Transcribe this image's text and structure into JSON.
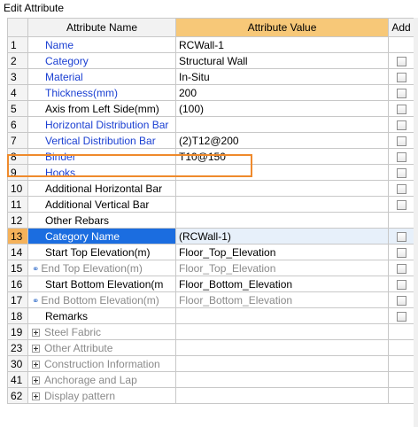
{
  "window": {
    "title": "Edit Attribute"
  },
  "header": {
    "num": "",
    "name": "Attribute Name",
    "value": "Attribute Value",
    "add": "Add"
  },
  "rows": [
    {
      "num": "1",
      "name": "Name",
      "value": "RCWall-1",
      "style": "blue",
      "add": false,
      "icon": ""
    },
    {
      "num": "2",
      "name": "Category",
      "value": "Structural Wall",
      "style": "blue",
      "add": true,
      "icon": ""
    },
    {
      "num": "3",
      "name": "Material",
      "value": "In-Situ",
      "style": "blue",
      "add": true,
      "icon": ""
    },
    {
      "num": "4",
      "name": "Thickness(mm)",
      "value": "200",
      "style": "blue",
      "add": true,
      "icon": ""
    },
    {
      "num": "5",
      "name": "Axis from Left Side(mm)",
      "value": "(100)",
      "style": "black",
      "add": true,
      "icon": ""
    },
    {
      "num": "6",
      "name": "Horizontal Distribution Bar",
      "value": "",
      "style": "blue",
      "add": true,
      "icon": ""
    },
    {
      "num": "7",
      "name": "Vertical Distribution Bar",
      "value": "(2)T12@200",
      "style": "blue",
      "add": true,
      "icon": ""
    },
    {
      "num": "8",
      "name": "Binder",
      "value": "T10@150",
      "style": "blue",
      "add": true,
      "icon": ""
    },
    {
      "num": "9",
      "name": "Hooks",
      "value": "",
      "style": "blue",
      "add": true,
      "icon": ""
    },
    {
      "num": "10",
      "name": "Additional Horizontal Bar",
      "value": "",
      "style": "black",
      "add": true,
      "icon": ""
    },
    {
      "num": "11",
      "name": "Additional Vertical Bar",
      "value": "",
      "style": "black",
      "add": true,
      "icon": ""
    },
    {
      "num": "12",
      "name": "Other Rebars",
      "value": "",
      "style": "black",
      "add": false,
      "icon": ""
    },
    {
      "num": "13",
      "name": "Category Name",
      "value": "(RCWall-1)",
      "style": "sel",
      "add": true,
      "icon": ""
    },
    {
      "num": "14",
      "name": "Start Top Elevation(m)",
      "value": "Floor_Top_Elevation",
      "style": "black",
      "add": true,
      "icon": ""
    },
    {
      "num": "15",
      "name": "End Top Elevation(m)",
      "value": "Floor_Top_Elevation",
      "style": "grey",
      "add": true,
      "icon": "link"
    },
    {
      "num": "16",
      "name": "Start Bottom Elevation(m",
      "value": "Floor_Bottom_Elevation",
      "style": "black",
      "add": true,
      "icon": ""
    },
    {
      "num": "17",
      "name": "End Bottom Elevation(m)",
      "value": "Floor_Bottom_Elevation",
      "style": "grey",
      "add": true,
      "icon": "link"
    },
    {
      "num": "18",
      "name": "Remarks",
      "value": "",
      "style": "black",
      "add": true,
      "icon": ""
    },
    {
      "num": "19",
      "name": "Steel Fabric",
      "value": "",
      "style": "grey",
      "add": null,
      "icon": "expand"
    },
    {
      "num": "23",
      "name": "Other Attribute",
      "value": "",
      "style": "grey",
      "add": null,
      "icon": "expand"
    },
    {
      "num": "30",
      "name": "Construction Information",
      "value": "",
      "style": "grey",
      "add": null,
      "icon": "expand"
    },
    {
      "num": "41",
      "name": "Anchorage and Lap",
      "value": "",
      "style": "grey",
      "add": null,
      "icon": "expand"
    },
    {
      "num": "62",
      "name": "Display pattern",
      "value": "",
      "style": "grey",
      "add": null,
      "icon": "expand"
    }
  ],
  "colors": {
    "highlight": "#ef8a2c",
    "selection": "#1b6de0",
    "link": "#1a3fd2",
    "header_accent": "#f7c878"
  }
}
